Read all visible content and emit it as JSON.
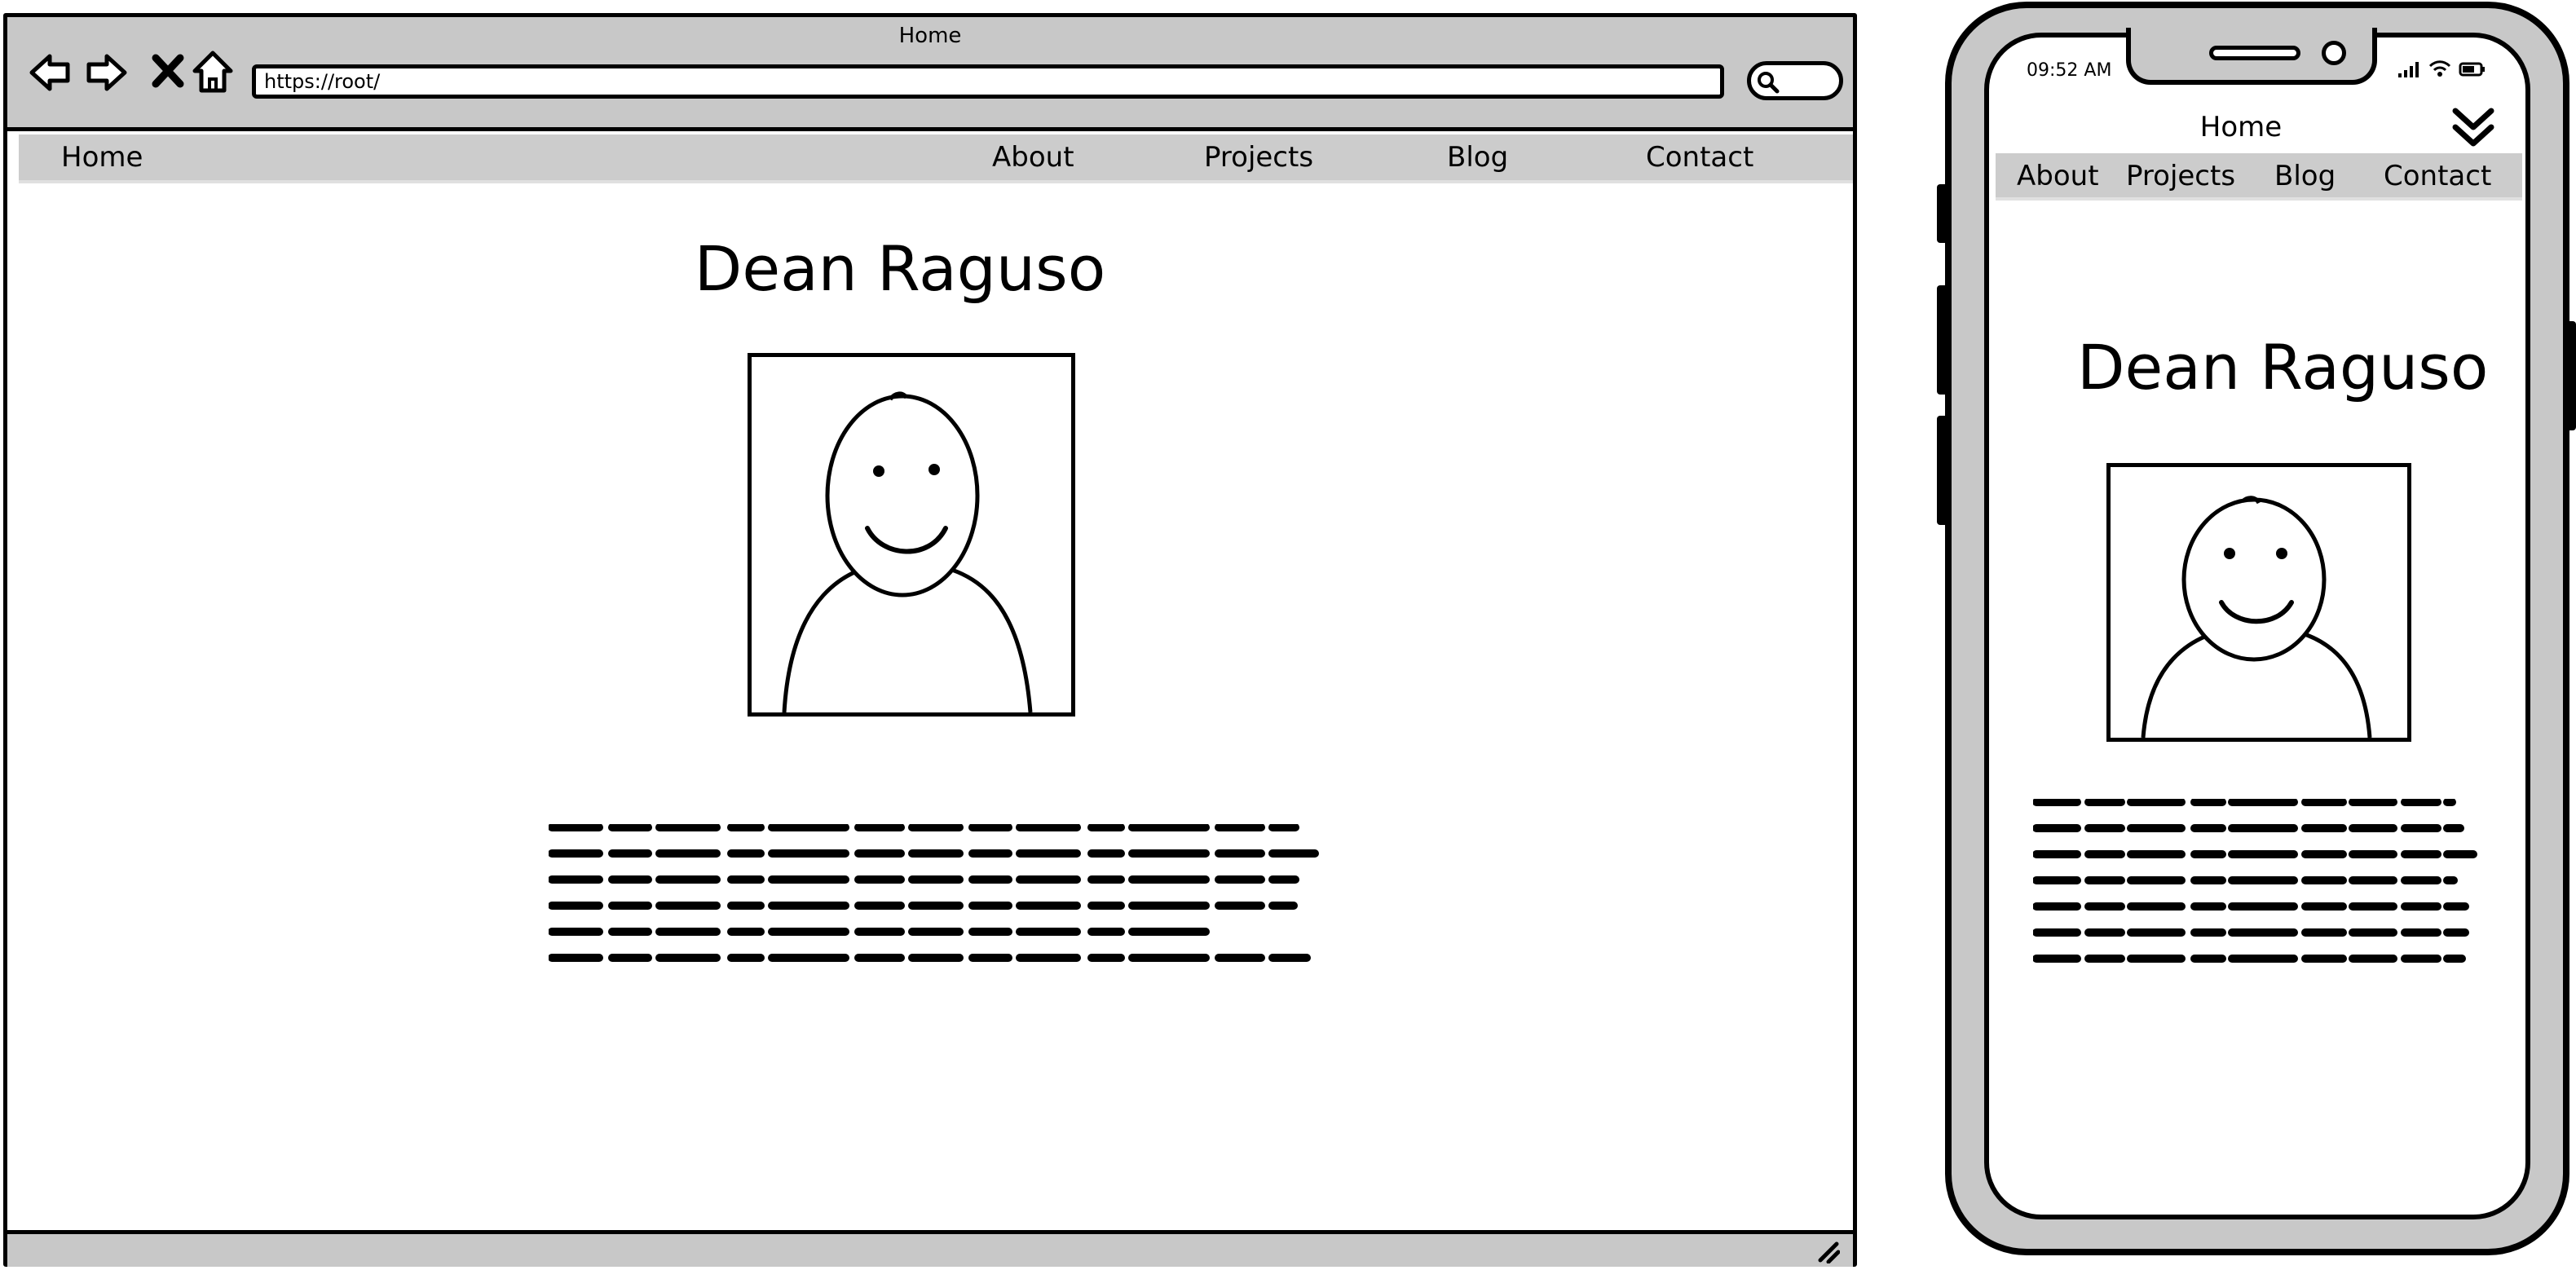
{
  "browser": {
    "window_title": "Home",
    "url": "https://root/",
    "nav_icons": [
      "back-arrow-icon",
      "forward-arrow-icon",
      "close-x-icon",
      "home-icon"
    ],
    "search_icon": "search-icon",
    "menu": {
      "home": "Home",
      "about": "About",
      "projects": "Projects",
      "blog": "Blog",
      "contact": "Contact"
    },
    "page_title": "Dean Raguso",
    "resize_icon": "resize-grip-icon"
  },
  "phone": {
    "status_time": "09:52 AM",
    "status_icons": [
      "signal-icon",
      "wifi-icon",
      "battery-icon"
    ],
    "header_title": "Home",
    "menu_toggle_icon": "double-chevron-down-icon",
    "menu": {
      "about": "About",
      "projects": "Projects",
      "blog": "Blog",
      "contact": "Contact"
    },
    "page_title": "Dean Raguso"
  },
  "colors": {
    "chrome_gray": "#c8c8c8",
    "menu_gray": "#cccccc",
    "ink": "#000000",
    "background": "#ffffff"
  }
}
